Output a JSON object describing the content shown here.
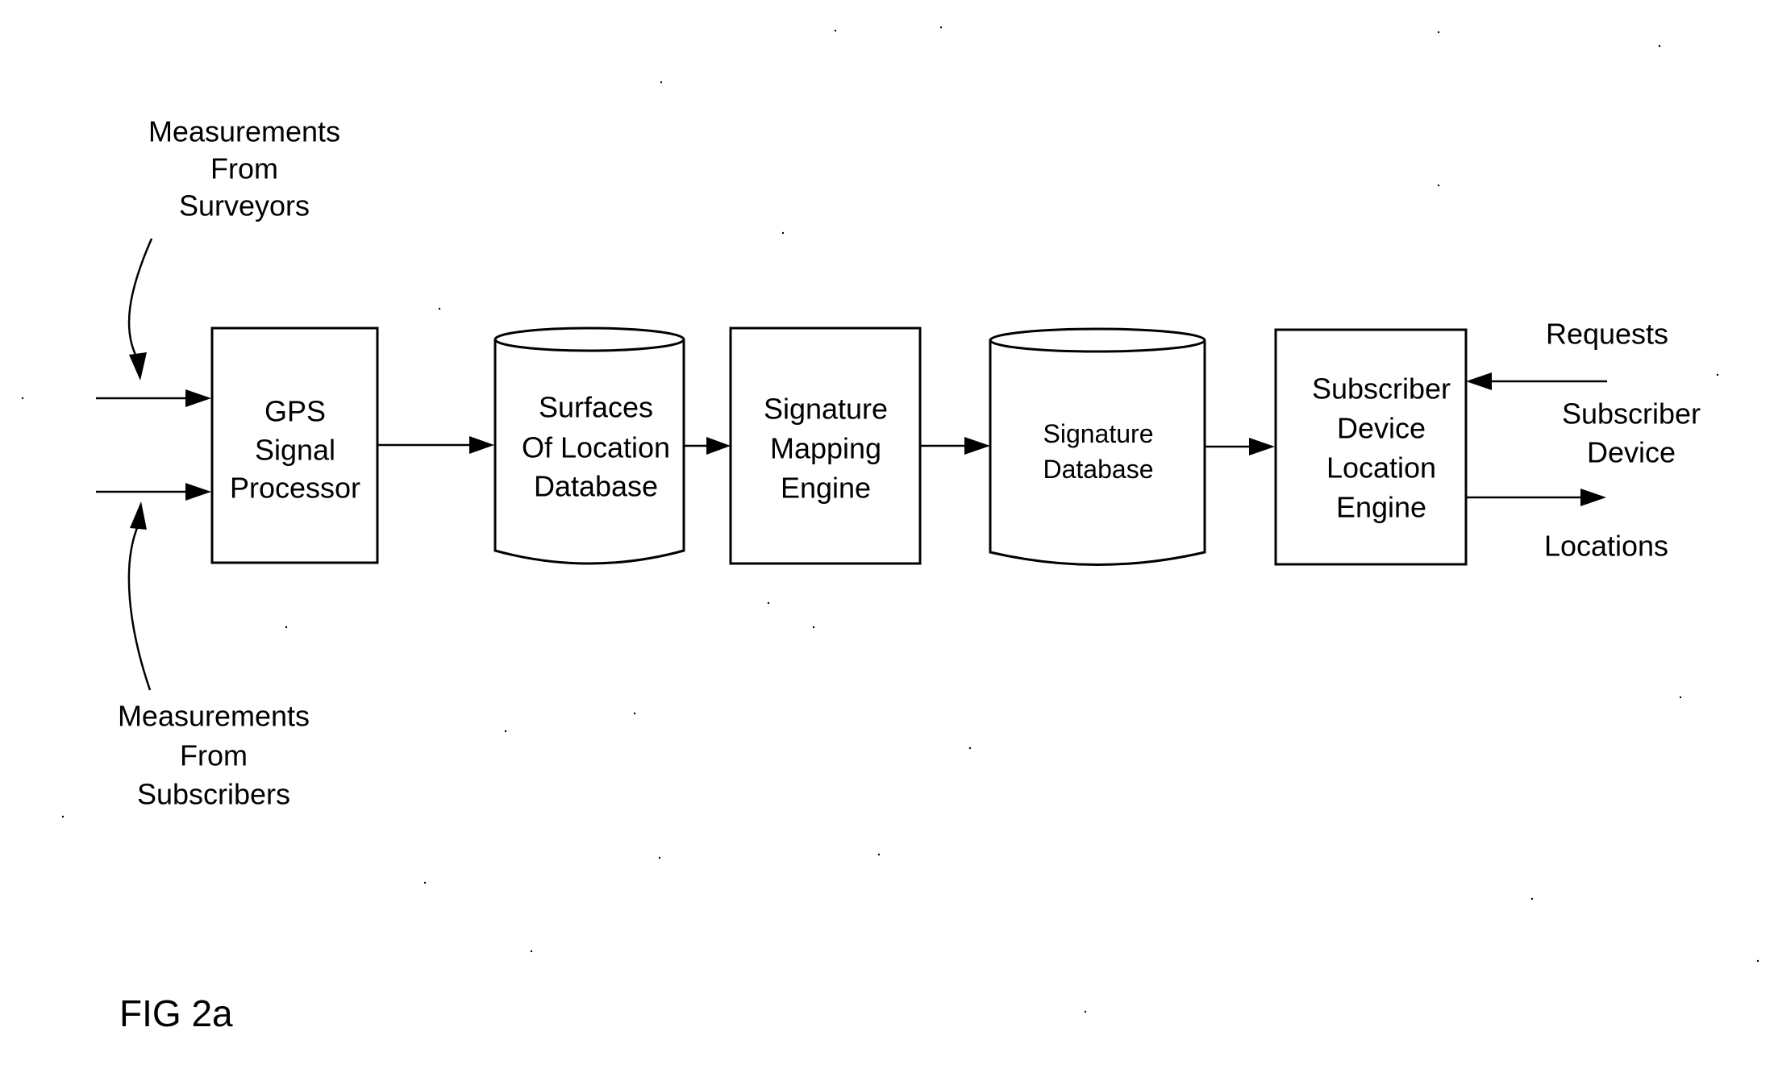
{
  "figure": {
    "label": "FIG 2a"
  },
  "inputs": {
    "surveyors": {
      "lines": [
        "Measurements",
        "From",
        "Surveyors"
      ]
    },
    "subscribers": {
      "lines": [
        "Measurements",
        "From",
        "Subscribers"
      ]
    }
  },
  "blocks": [
    {
      "id": "gps-signal-processor",
      "type": "process",
      "lines": [
        "GPS",
        "Signal",
        "Processor"
      ]
    },
    {
      "id": "surfaces-of-location-database",
      "type": "database",
      "lines": [
        "Surfaces",
        "Of Location",
        "Database"
      ]
    },
    {
      "id": "signature-mapping-engine",
      "type": "process",
      "lines": [
        "Signature",
        "Mapping",
        "Engine"
      ]
    },
    {
      "id": "signature-database",
      "type": "database",
      "lines": [
        "Signature",
        "Database"
      ]
    },
    {
      "id": "subscriber-device-location-engine",
      "type": "process",
      "lines": [
        "Subscriber",
        "Device",
        "Location",
        "Engine"
      ]
    }
  ],
  "external": {
    "requests_label": "Requests",
    "subscriber_device": {
      "lines": [
        "Subscriber",
        "Device"
      ]
    },
    "locations_label": "Locations"
  },
  "connections": [
    {
      "from": "measurements-from-surveyors",
      "to": "gps-signal-processor"
    },
    {
      "from": "measurements-from-subscribers",
      "to": "gps-signal-processor"
    },
    {
      "from": "gps-signal-processor",
      "to": "surfaces-of-location-database"
    },
    {
      "from": "surfaces-of-location-database",
      "to": "signature-mapping-engine"
    },
    {
      "from": "signature-mapping-engine",
      "to": "signature-database"
    },
    {
      "from": "signature-database",
      "to": "subscriber-device-location-engine"
    },
    {
      "from": "subscriber-device",
      "to": "subscriber-device-location-engine",
      "label": "Requests"
    },
    {
      "from": "subscriber-device-location-engine",
      "to": "subscriber-device",
      "label": "Locations"
    }
  ]
}
